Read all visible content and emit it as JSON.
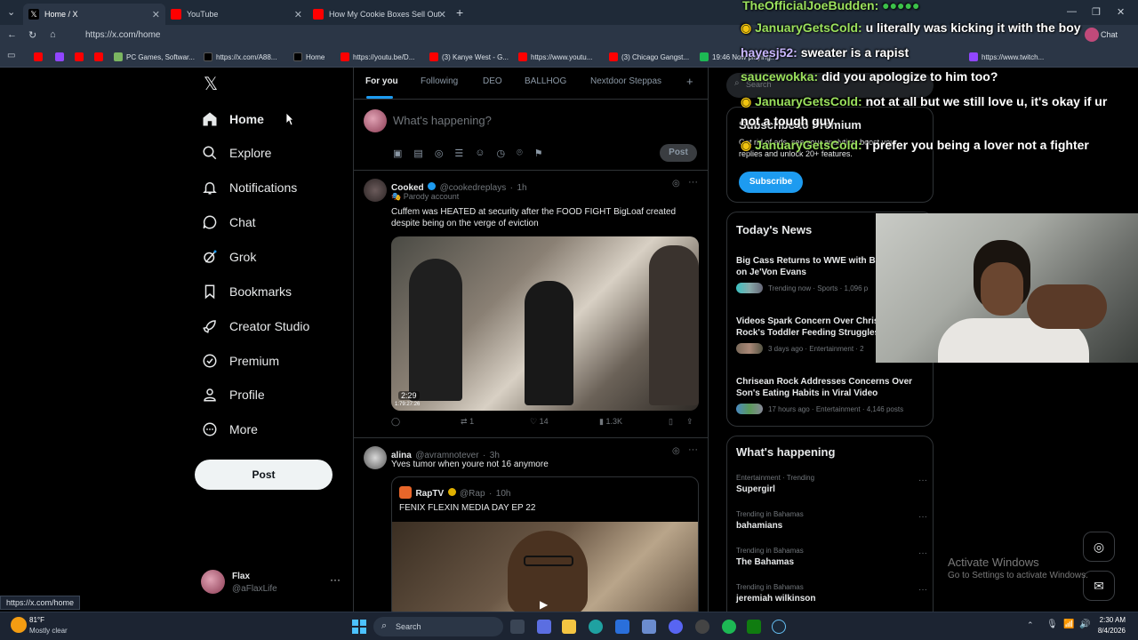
{
  "browser": {
    "tabs": [
      {
        "title": "Home / X",
        "active": true
      },
      {
        "title": "YouTube",
        "active": false
      },
      {
        "title": "How My Cookie Boxes Sell Out Ev",
        "active": false
      }
    ],
    "url": "https://x.com/home",
    "chat_label": "Chat",
    "bookmarks": [
      "PC Games, Softwar...",
      "https://x.com/A88...",
      "Home",
      "https://youtu.be/D...",
      "(3) Kanye West - G...",
      "https://www.youtu...",
      "(3) Chicago Gangst...",
      "19:46 Now playing...",
      "https://www.twitch..."
    ]
  },
  "nav": {
    "items": [
      {
        "label": "Home",
        "icon": "home-icon"
      },
      {
        "label": "Explore",
        "icon": "search-icon"
      },
      {
        "label": "Notifications",
        "icon": "bell-icon"
      },
      {
        "label": "Chat",
        "icon": "chat-icon"
      },
      {
        "label": "Grok",
        "icon": "grok-icon"
      },
      {
        "label": "Bookmarks",
        "icon": "bookmark-icon"
      },
      {
        "label": "Creator Studio",
        "icon": "rocket-icon"
      },
      {
        "label": "Premium",
        "icon": "premium-icon"
      },
      {
        "label": "Profile",
        "icon": "person-icon"
      },
      {
        "label": "More",
        "icon": "more-circle-icon"
      }
    ],
    "post_label": "Post",
    "user_name": "Flax",
    "user_handle": "@aFlaxLife"
  },
  "feed": {
    "tabs": [
      "For you",
      "Following",
      "DEO",
      "BALLHOG",
      "Nextdoor Steppas"
    ],
    "composer_placeholder": "What's happening?",
    "composer_post": "Post",
    "tweets": [
      {
        "name": "Cooked",
        "handle": "@cookedreplays",
        "time": "1h",
        "badge": "Parody account",
        "text": "Cuffem was HEATED at security after the FOOD FIGHT BigLoaf created despite being on the verge of eviction",
        "duration": "2:29",
        "counter": "1:79:27:26",
        "retweets": "1",
        "likes": "14",
        "views": "1.3K"
      },
      {
        "name": "alina",
        "handle": "@avramnotever",
        "time": "3h",
        "text": "Yves tumor when youre not 16 anymore",
        "quote_name": "RapTV",
        "quote_handle": "@Rap",
        "quote_time": "10h",
        "quote_text": "FENIX FLEXIN MEDIA DAY EP 22"
      }
    ]
  },
  "right": {
    "search_placeholder": "Search",
    "premium_title": "Subscribe to Premium",
    "premium_text_1": "Get rid of ads, see your analytics, boost your",
    "premium_text_2": "replies and unlock 20+ features.",
    "subscribe_label": "Subscribe",
    "news_header": "Today's News",
    "news": [
      {
        "title_1": "Big Cass Returns to WWE with Br",
        "title_2": "on Je'Von Evans",
        "meta": "Trending now · Sports · 1,096 p"
      },
      {
        "title_1": "Videos Spark Concern Over Chris",
        "title_2": "Rock's Toddler Feeding Struggles",
        "meta": "3 days ago · Entertainment · 2"
      },
      {
        "title_1": "Chrisean Rock Addresses Concerns Over",
        "title_2": "Son's Eating Habits in Viral Video",
        "meta": "17 hours ago · Entertainment · 4,146 posts"
      }
    ],
    "happening_header": "What's happening",
    "trends": [
      {
        "category": "Entertainment · Trending",
        "name": "Supergirl"
      },
      {
        "category": "Trending in Bahamas",
        "name": "bahamians"
      },
      {
        "category": "Trending in Bahamas",
        "name": "The Bahamas"
      },
      {
        "category": "Trending in Bahamas",
        "name": "jeremiah wilkinson"
      }
    ]
  },
  "overlay_chat": [
    {
      "user": "TheOfficialJoeBudden:",
      "msg": ""
    },
    {
      "user": "JanuaryGetsCold:",
      "msg": "u literally was kicking it with the boy"
    },
    {
      "user": "hayesj52:",
      "msg": "sweater is a rapist"
    },
    {
      "user": "saucewokka:",
      "msg": "did you apologize to him too?"
    },
    {
      "user": "JanuaryGetsCold:",
      "msg": "not at all but we still love u, it's okay if ur"
    },
    {
      "user": "",
      "msg": "not a tough guy"
    },
    {
      "user": "JanuaryGetsCold:",
      "msg": "i prefer you being a lover not a fighter"
    }
  ],
  "watermark": {
    "title": "Activate Windows",
    "sub": "Go to Settings to activate Windows."
  },
  "status_url": "https://x.com/home",
  "taskbar": {
    "weather_temp": "81°F",
    "weather_desc": "Mostly clear",
    "search_label": "Search",
    "time": "2:30 AM",
    "date": "8/4/2026"
  }
}
